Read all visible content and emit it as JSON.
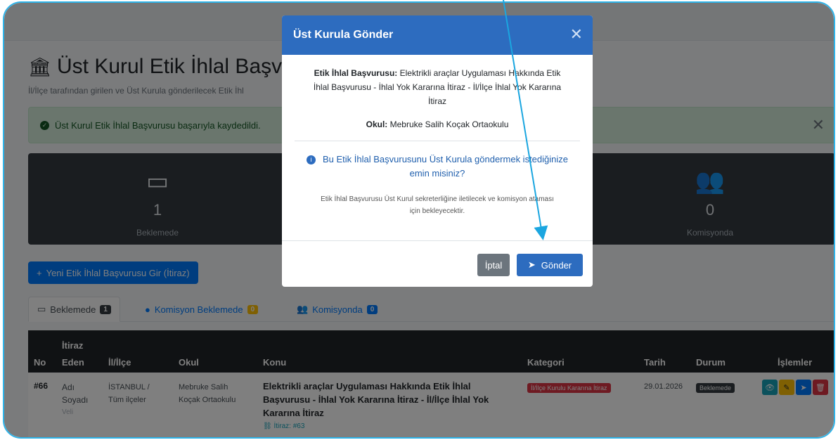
{
  "page": {
    "title": "Üst Kurul Etik İhlal Başvur",
    "subtitle": "İl/İlçe tarafından girilen ve Üst Kurula gönderilecek Etik İhl",
    "alert": "Üst Kurul Etik İhlal Başvurusu başarıyla kaydedildi.",
    "stats": [
      {
        "icon": "inbox-icon",
        "value": "1",
        "label": "Beklemede"
      },
      {
        "icon": "users-icon",
        "value": "0",
        "label": "Komisyonda"
      }
    ],
    "new_button": "Yeni Etik İhlal Başvurusu Gir (İtiraz)",
    "tabs": [
      {
        "label": "Beklemede",
        "count": "1"
      },
      {
        "label": "Komisyon Beklemede",
        "count": "0"
      },
      {
        "label": "Komisyonda",
        "count": "0"
      }
    ],
    "table": {
      "headers": {
        "no": "No",
        "itiraz": "İtiraz",
        "eden": "Eden",
        "il": "İl/İlçe",
        "okul": "Okul",
        "konu": "Konu",
        "kategori": "Kategori",
        "tarih": "Tarih",
        "durum": "Durum",
        "islemler": "İşlemler"
      },
      "row": {
        "no": "#66",
        "eden_1": "Adı",
        "eden_2": "Soyadı",
        "eden_3": "Veli",
        "il_1": "İSTANBUL /",
        "il_2": "Tüm ilçeler",
        "okul_1": "Mebruke Salih",
        "okul_2": "Koçak Ortaokulu",
        "konu_1": "Elektrikli araçlar Uygulaması Hakkında Etik İhlal",
        "konu_2": "Başvurusu - İhlal Yok Kararına İtiraz - İl/İlçe İhlal Yok",
        "konu_3": "Kararına İtiraz",
        "konu_link": "İtiraz: #63",
        "kategori": "İl/İlçe Kurulu Kararına İtiraz",
        "tarih": "29.01.2026",
        "durum": "Beklemede"
      }
    }
  },
  "modal": {
    "title": "Üst Kurula Gönder",
    "info_label": "Etik İhlal Başvurusu:",
    "info_line_1": "Elektrikli araçlar Uygulaması Hakkında Etik",
    "info_line_2": "İhlal Başvurusu - İhlal Yok Kararına İtiraz - İl/İlçe İhlal Yok Kararına",
    "info_line_3": "İtiraz",
    "school_label": "Okul:",
    "school_value": "Mebruke Salih Koçak Ortaokulu",
    "question_1": "Bu Etik İhlal Başvurusunu Üst Kurula göndermek istediğinize",
    "question_2": "emin misiniz?",
    "note_1": "Etik İhlal Başvurusu Üst Kurul sekreterliğine iletilecek ve komisyon ataması",
    "note_2": "için bekleyecektir.",
    "cancel": "İptal",
    "send": "Gönder"
  },
  "colors": {
    "accent": "#2d6cbf",
    "annotation_arrow": "#1ba6e0",
    "frame": "#2fb3e8",
    "danger": "#dc3545",
    "warning": "#ffc107"
  }
}
